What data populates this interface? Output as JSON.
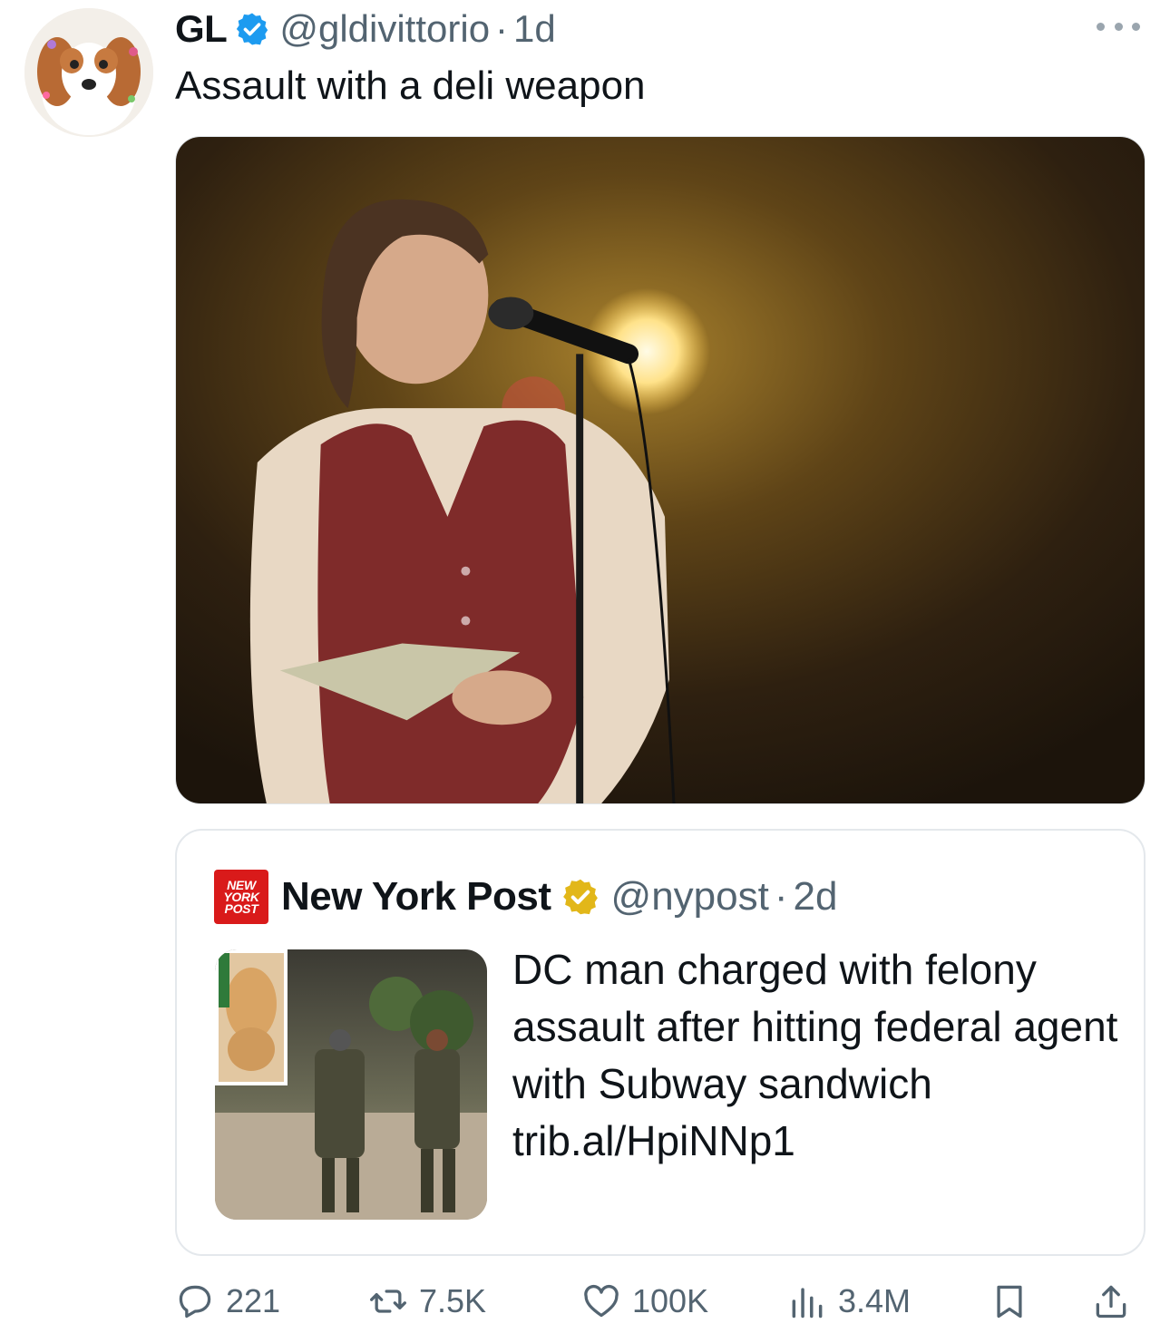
{
  "tweet": {
    "author_name": "GL",
    "handle": "@gldivittorio",
    "separator": "·",
    "time": "1d",
    "text": "Assault with a deli weapon",
    "avatar_icon": "dog-avatar-icon",
    "verified_color": "#1d9bf0"
  },
  "quote": {
    "logo_lines": [
      "NEW",
      "YORK",
      "POST"
    ],
    "author_name": "New York Post",
    "handle": "@nypost",
    "separator": "·",
    "time": "2d",
    "text": "DC man charged with felony assault after hitting federal agent with Subway sandwich trib.al/HpiNNp1",
    "verified_color": "#e2b719",
    "logo_color": "#d91a1a"
  },
  "actions": {
    "replies": "221",
    "reposts": "7.5K",
    "likes": "100K",
    "views": "3.4M"
  },
  "colors": {
    "text_primary": "#0f1419",
    "text_secondary": "#536471",
    "border": "#e4e8ec"
  }
}
